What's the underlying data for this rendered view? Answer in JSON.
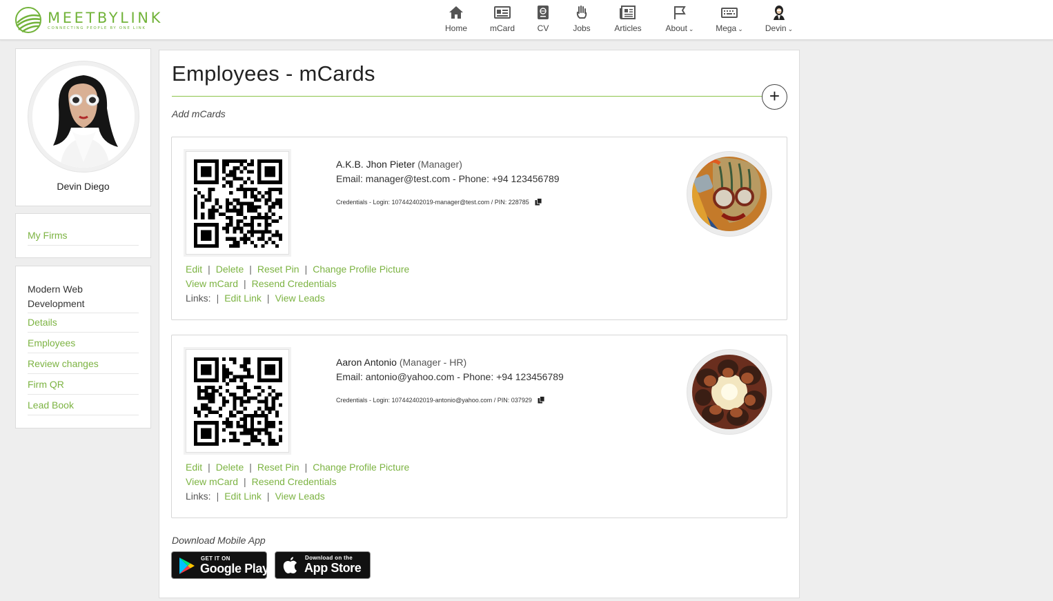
{
  "brand": {
    "name": "MEETBYLINK",
    "tagline": "CONNECTING PEOPLE BY ONE LINK",
    "accent": "#7cb342"
  },
  "nav": [
    {
      "label": "Home",
      "icon": "home-icon"
    },
    {
      "label": "mCard",
      "icon": "id-card-icon"
    },
    {
      "label": "CV",
      "icon": "passport-icon"
    },
    {
      "label": "Jobs",
      "icon": "hand-icon"
    },
    {
      "label": "Articles",
      "icon": "newspaper-icon"
    },
    {
      "label": "About",
      "icon": "flag-icon",
      "dropdown": true
    },
    {
      "label": "Mega",
      "icon": "keyboard-icon",
      "dropdown": true
    },
    {
      "label": "Devin",
      "icon": "user-avatar-icon",
      "dropdown": true
    }
  ],
  "sidebar": {
    "profile_name": "Devin Diego",
    "firms_link": "My Firms",
    "firm_name": "Modern Web Development",
    "firm_links": [
      "Details",
      "Employees",
      "Review changes",
      "Firm QR",
      "Lead Book"
    ]
  },
  "main": {
    "title": "Employees - mCards",
    "add_caption": "Add mCards",
    "add_button": "+",
    "employees": [
      {
        "name": "A.K.B. Jhon Pieter",
        "role": "(Manager)",
        "contact": "Email: manager@test.com - Phone: +94 123456789",
        "credentials": "Credentials - Login: 107442402019-manager@test.com / PIN: 228785"
      },
      {
        "name": "Aaron Antonio",
        "role": "(Manager - HR)",
        "contact": "Email: antonio@yahoo.com - Phone: +94 123456789",
        "credentials": "Credentials - Login: 107442402019-antonio@yahoo.com / PIN: 037929"
      }
    ],
    "actions": {
      "edit": "Edit",
      "delete": "Delete",
      "reset_pin": "Reset Pin",
      "change_picture": "Change Profile Picture",
      "view_mcard": "View mCard",
      "resend": "Resend Credentials",
      "links_label": "Links:",
      "edit_link": "Edit Link",
      "view_leads": "View Leads",
      "separator": "|"
    },
    "download_caption": "Download Mobile App",
    "google_play": {
      "small": "GET IT ON",
      "big": "Google Play"
    },
    "app_store": {
      "small": "Download on the",
      "big": "App Store"
    }
  }
}
